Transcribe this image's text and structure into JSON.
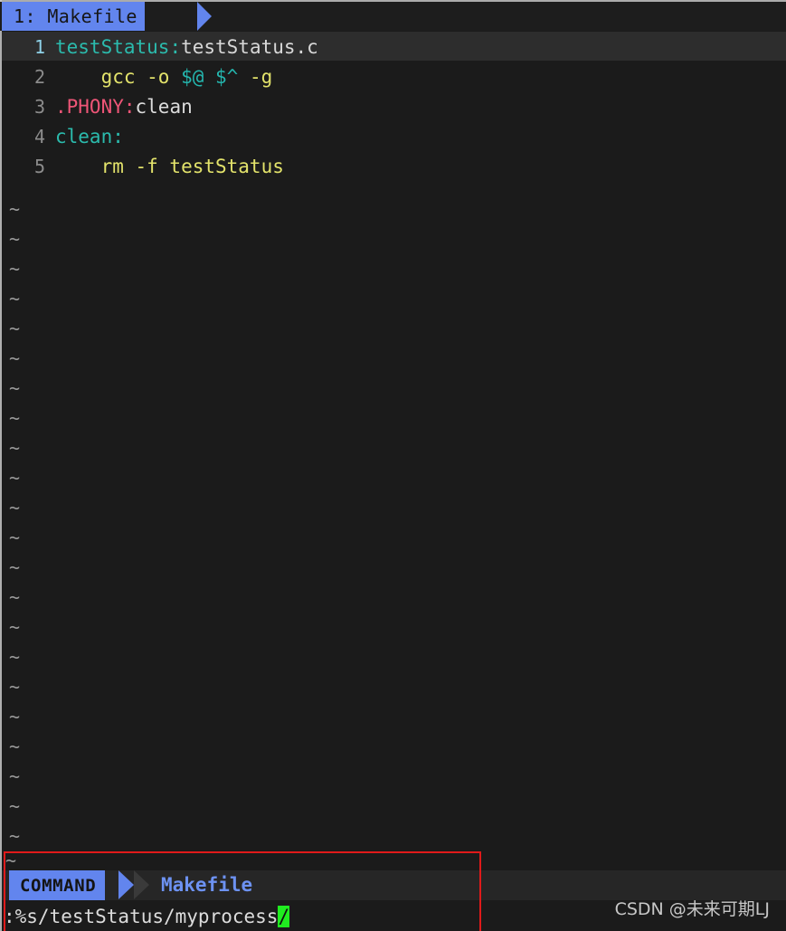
{
  "app": {
    "kind": "vim-editor",
    "background": "#1b1b1b",
    "accent": "#6285ee",
    "cursor_color": "#20ec20",
    "annotation_color": "#e01a1a"
  },
  "tabline": {
    "tabs": [
      {
        "label": "1: Makefile",
        "active": true
      }
    ]
  },
  "editor": {
    "filename": "Makefile",
    "cursor_line": 1,
    "lines": [
      {
        "number": "1",
        "current": true,
        "tokens": [
          {
            "text": "testStatus",
            "class": "s-target"
          },
          {
            "text": ":",
            "class": "s-colon"
          },
          {
            "text": "testStatus.c",
            "class": "s-dep"
          }
        ]
      },
      {
        "number": "2",
        "current": false,
        "tokens": [
          {
            "text": "    gcc -o ",
            "class": "s-cmd"
          },
          {
            "text": "$@",
            "class": "s-var"
          },
          {
            "text": " ",
            "class": "s-cmd"
          },
          {
            "text": "$^",
            "class": "s-var"
          },
          {
            "text": " -g",
            "class": "s-cmd"
          }
        ]
      },
      {
        "number": "3",
        "current": false,
        "tokens": [
          {
            "text": ".PHONY",
            "class": "s-phony"
          },
          {
            "text": ":",
            "class": "s-phony"
          },
          {
            "text": "clean",
            "class": "s-plain"
          }
        ]
      },
      {
        "number": "4",
        "current": false,
        "tokens": [
          {
            "text": "clean",
            "class": "s-target"
          },
          {
            "text": ":",
            "class": "s-colon"
          }
        ]
      },
      {
        "number": "5",
        "current": false,
        "tokens": [
          {
            "text": "    rm -f testStatus",
            "class": "s-cmd"
          }
        ]
      }
    ],
    "filler_glyph": "~",
    "filler_count": 23
  },
  "statusline": {
    "mode": "COMMAND",
    "filename": "Makefile",
    "filler_glyph": "~"
  },
  "command_line": {
    "text": ":%s/testStatus/myprocess",
    "cursor_char": "/"
  },
  "watermark": {
    "text": "CSDN @未来可期LJ"
  }
}
